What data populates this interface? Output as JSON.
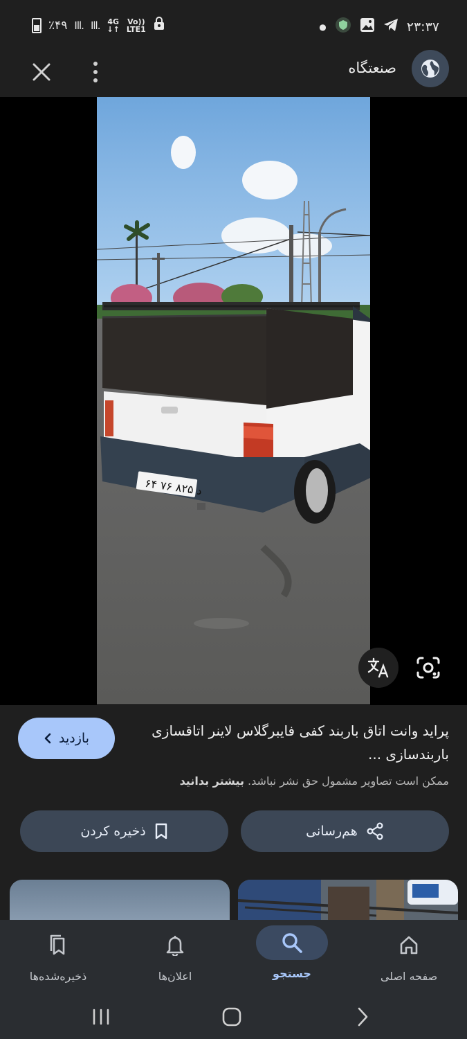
{
  "status_bar": {
    "battery": "٪۴۹",
    "network": "4G",
    "volte_line1": "Vo))",
    "volte_line2": "LTE1",
    "time": "۲۳:۳۷"
  },
  "app_bar": {
    "site_name": "صنعتگاه"
  },
  "photo": {
    "plate_text": "۶۴ د ۸۲۵ ۷۶"
  },
  "info": {
    "title": "پراید وانت اتاق باربند کفی فایبرگلاس لاینر اتاقسازی باربندسازی ...",
    "copyright_text": "ممکن است تصاویر مشمول حق نشر نباشد.",
    "learn_more": "بیشتر بدانید",
    "visit_label": "بازدید",
    "share_label": "هم‌رسانی",
    "save_label": "ذخیره کردن"
  },
  "bottom_nav": {
    "items": [
      {
        "label": "صفحه اصلی",
        "icon": "home-icon"
      },
      {
        "label": "جستجو",
        "icon": "search-icon",
        "active": true
      },
      {
        "label": "اعلان‌ها",
        "icon": "bell-icon"
      },
      {
        "label": "ذخیره‌شده‌ها",
        "icon": "bookmarks-icon"
      }
    ]
  },
  "colors": {
    "background": "#1f1f1f",
    "accent": "#a8c7fa",
    "chip": "#3c4756",
    "nav": "#2a2d31"
  }
}
